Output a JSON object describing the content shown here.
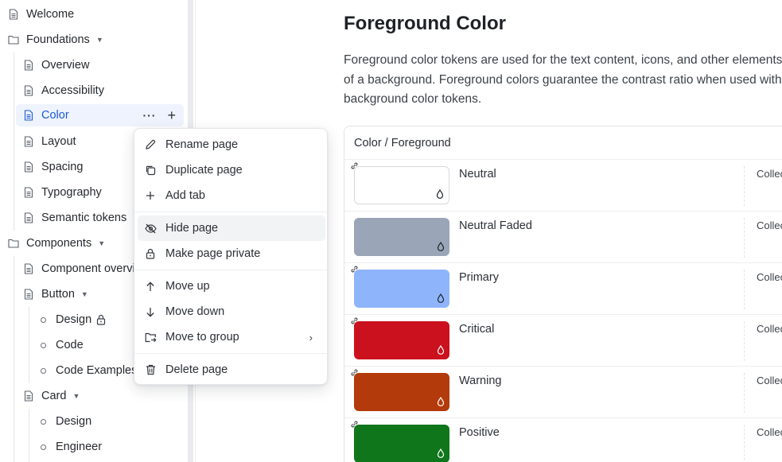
{
  "sidebar": {
    "welcome": "Welcome",
    "foundations": "Foundations",
    "foundations_items": [
      "Overview",
      "Accessibility",
      "Color",
      "Layout",
      "Spacing",
      "Typography",
      "Semantic tokens"
    ],
    "components": "Components",
    "component_overview": "Component overview",
    "button": "Button",
    "button_children": [
      "Design",
      "Code",
      "Code Examples"
    ],
    "card": "Card",
    "card_children": [
      "Design",
      "Engineer"
    ],
    "active_item": "Color"
  },
  "main": {
    "title": "Foreground Color",
    "description": [
      "Foreground color tokens are used for the text content, icons, and other elements on top",
      "of a background. Foreground colors guarantee the contrast ratio when used with the",
      "background color tokens."
    ],
    "table_header": "Color / Foreground",
    "column_label": "Collection",
    "tokens": [
      {
        "name": "Neutral",
        "color": "#ffffff"
      },
      {
        "name": "Neutral Faded",
        "color": "#9aa5b8"
      },
      {
        "name": "Primary",
        "color": "#8eb5fb"
      },
      {
        "name": "Critical",
        "color": "#cb111d"
      },
      {
        "name": "Warning",
        "color": "#b23a0b"
      },
      {
        "name": "Positive",
        "color": "#0f761c"
      }
    ]
  },
  "context_menu": {
    "items": [
      {
        "label": "Rename page",
        "icon": "pencil-icon"
      },
      {
        "label": "Duplicate page",
        "icon": "duplicate-icon"
      },
      {
        "label": "Add tab",
        "icon": "plus-icon"
      },
      {
        "label": "Hide page",
        "icon": "eye-off-icon"
      },
      {
        "label": "Make page private",
        "icon": "lock-icon"
      },
      {
        "label": "Move up",
        "icon": "arrow-up-icon"
      },
      {
        "label": "Move down",
        "icon": "arrow-down-icon"
      },
      {
        "label": "Move to group",
        "icon": "folder-move-icon"
      },
      {
        "label": "Delete page",
        "icon": "trash-icon"
      }
    ],
    "hovered_item": "Hide page"
  },
  "colors": {
    "accent": "#1c5bd6",
    "active_bg": "#eef3fd"
  }
}
